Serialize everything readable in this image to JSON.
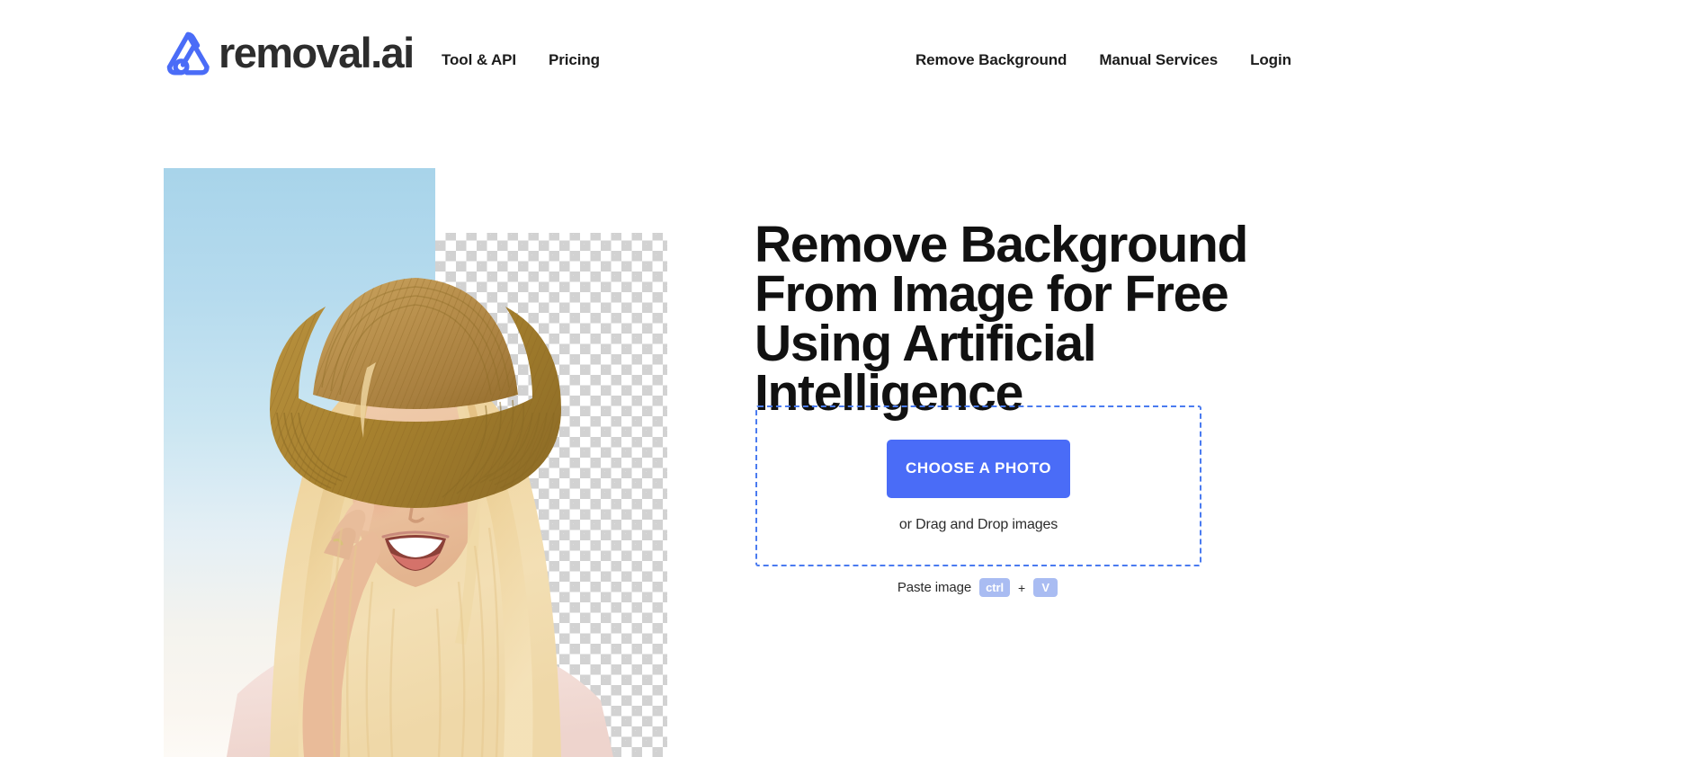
{
  "header": {
    "logo": {
      "icon": "removal-ai-logo-icon",
      "text": "removal.ai",
      "color": "#4a6cf7"
    },
    "nav_left": [
      {
        "label": "Tool & API"
      },
      {
        "label": "Pricing"
      }
    ],
    "nav_right": [
      {
        "label": "Remove Background"
      },
      {
        "label": "Manual Services"
      },
      {
        "label": "Login"
      }
    ]
  },
  "hero": {
    "headline": "Remove Background From Image for Free Using Artificial Intelligence",
    "photo": {
      "alt": "Smiling blonde woman wearing a straw hat, left half shows original blue sky background, right half shows transparent checkerboard after background removal",
      "left_background": "blue-sky-gradient",
      "right_background": "transparency-checkerboard"
    },
    "dropzone": {
      "button_label": "CHOOSE A PHOTO",
      "drag_text": "or Drag and Drop images",
      "border_color": "#4a7bf0",
      "button_color": "#4a6cf7"
    },
    "paste": {
      "label": "Paste image",
      "key_1": "ctrl",
      "separator": "+",
      "key_2": "V",
      "key_color": "#a9bcf2"
    }
  }
}
